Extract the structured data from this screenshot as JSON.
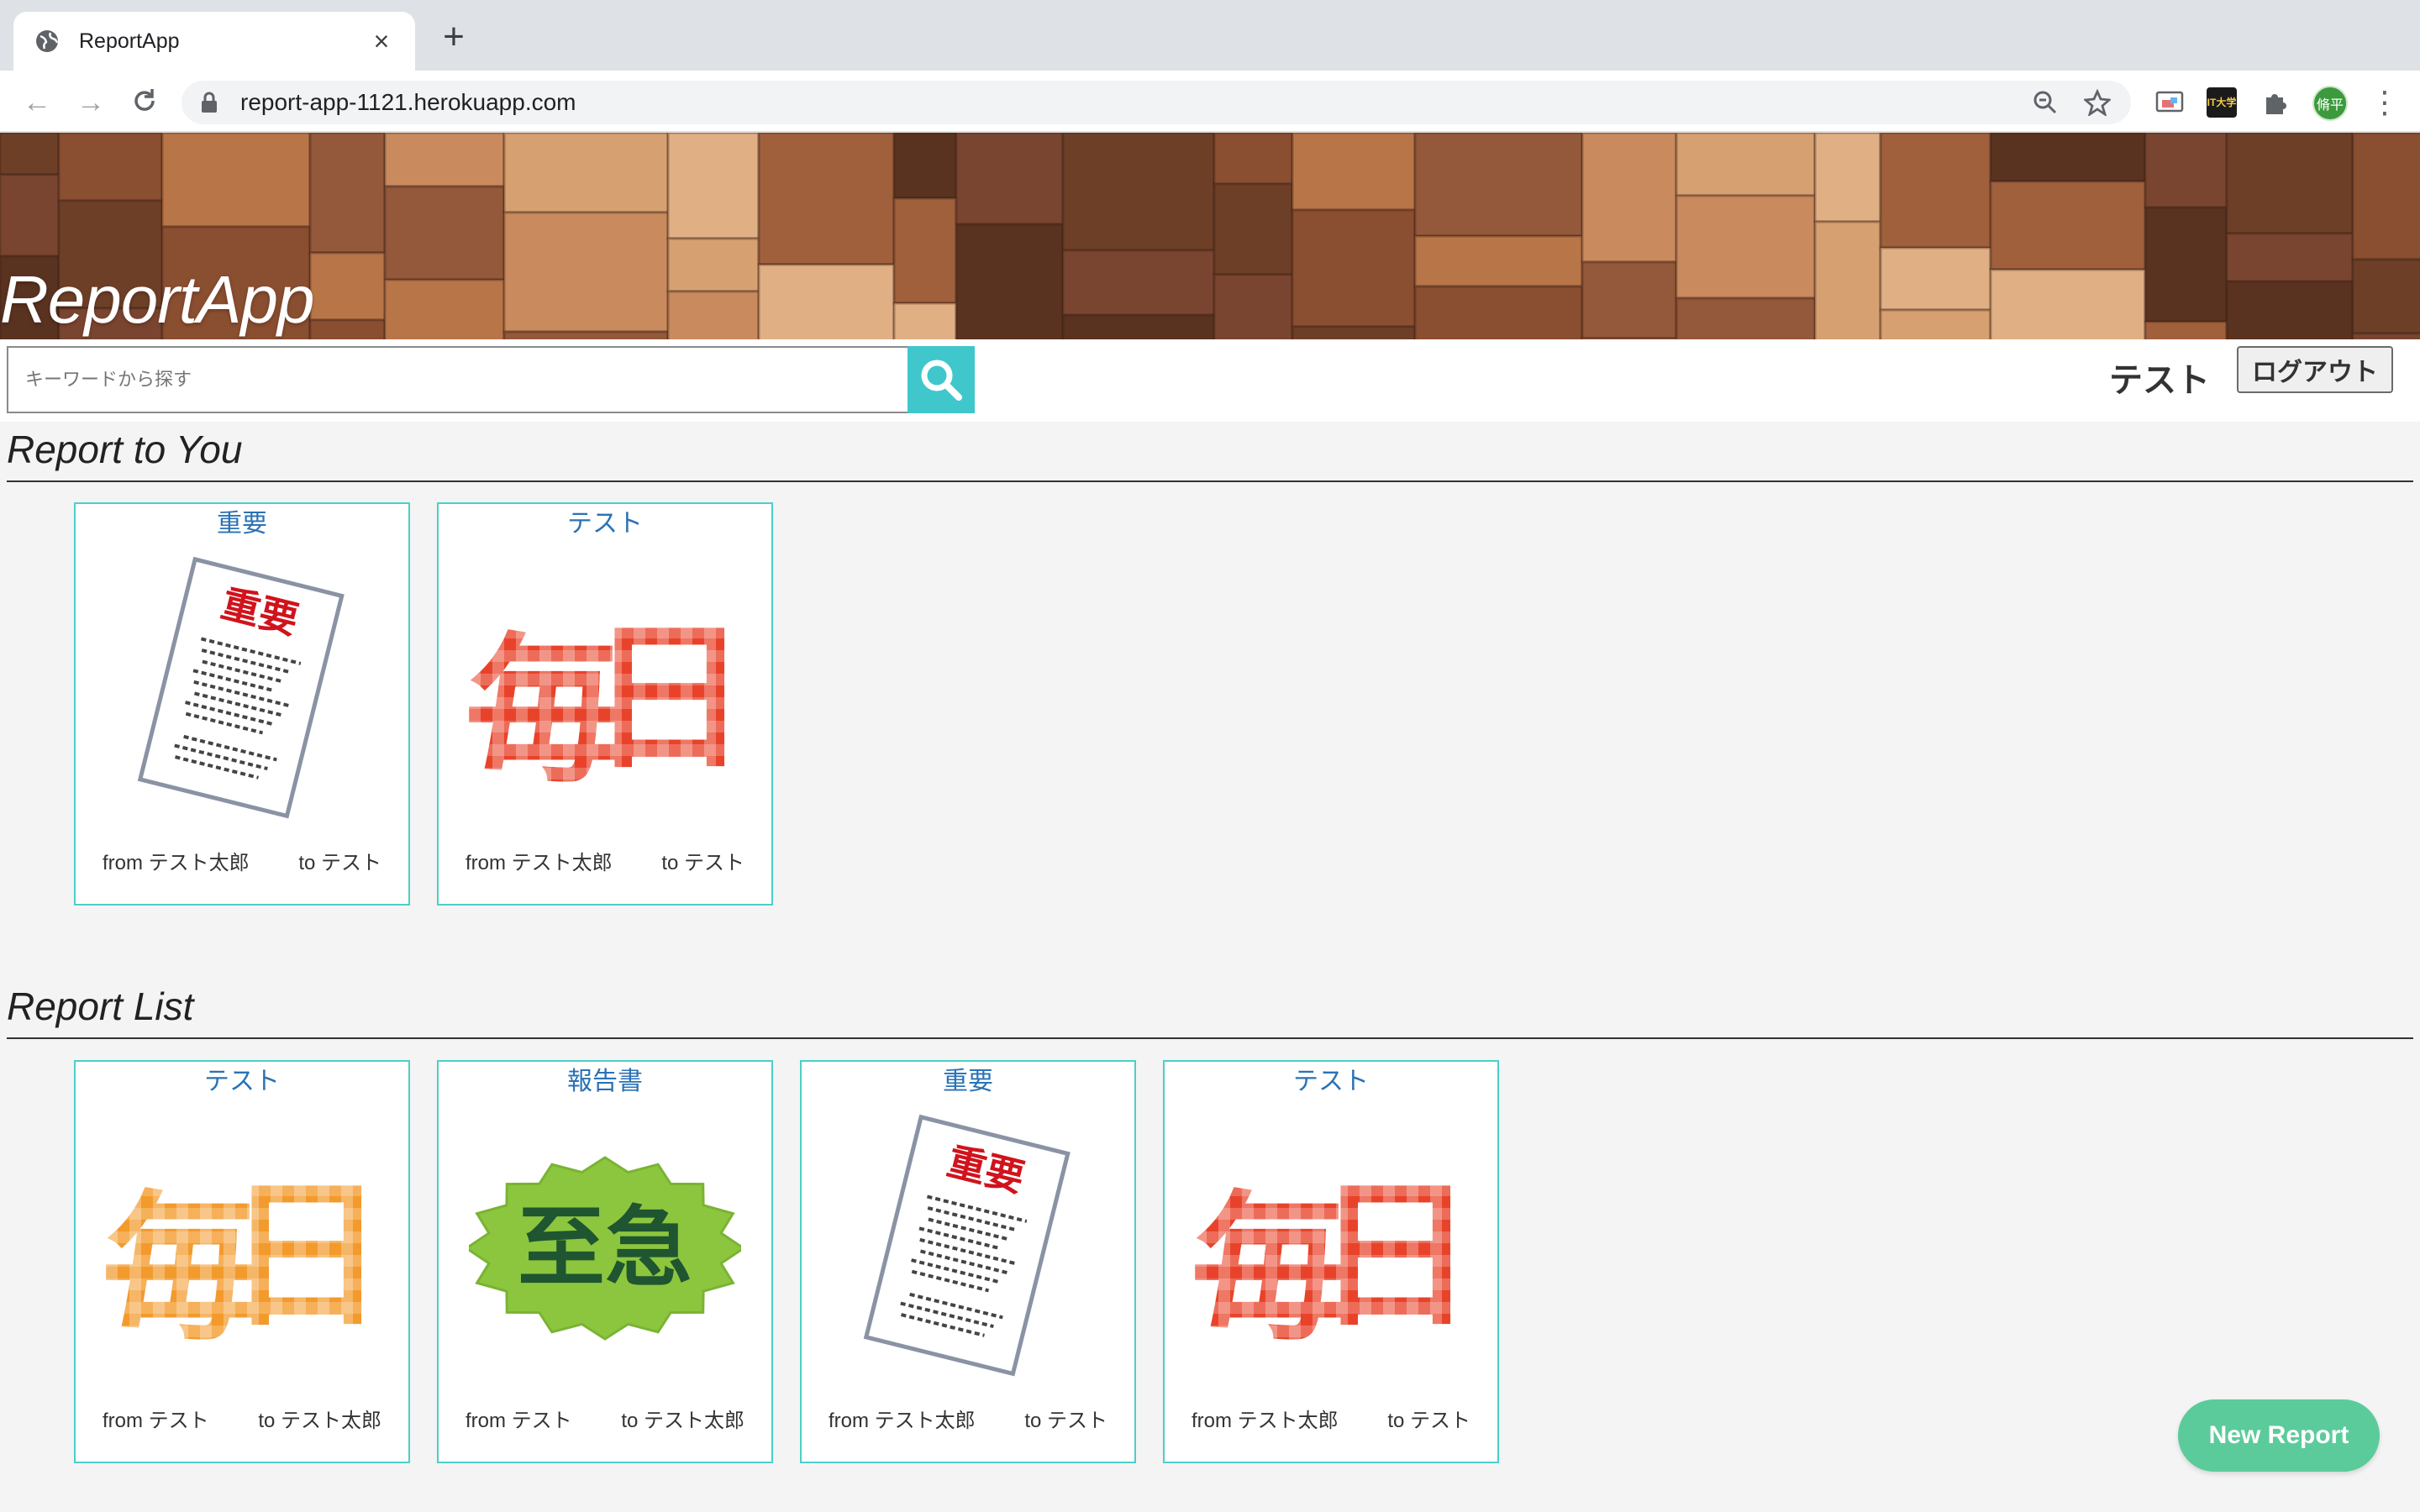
{
  "browser": {
    "tab_title": "ReportApp",
    "url": "report-app-1121.herokuapp.com",
    "profile_initials": "脩平",
    "ext_label": "IT大学"
  },
  "app": {
    "brand": "ReportApp",
    "search_placeholder": "キーワードから探す",
    "user_name": "テスト",
    "logout_label": "ログアウト",
    "new_report_label": "New Report"
  },
  "sections": {
    "to_you": {
      "title": "Report to You",
      "cards": [
        {
          "title": "重要",
          "image": "important-document-illustration",
          "from": "from テスト太郎",
          "to": "to テスト"
        },
        {
          "title": "テスト",
          "image": "mainichi-red-illustration",
          "from": "from テスト太郎",
          "to": "to テスト"
        }
      ]
    },
    "list": {
      "title": "Report List",
      "cards": [
        {
          "title": "テスト",
          "image": "mainichi-orange-illustration",
          "from": "from テスト",
          "to": "to テスト太郎"
        },
        {
          "title": "報告書",
          "image": "shikyu-urgent-illustration",
          "from": "from テスト",
          "to": "to テスト太郎"
        },
        {
          "title": "重要",
          "image": "important-document-illustration",
          "from": "from テスト太郎",
          "to": "to テスト"
        },
        {
          "title": "テスト",
          "image": "mainichi-red-illustration",
          "from": "from テスト太郎",
          "to": "to テスト"
        }
      ]
    }
  },
  "colors": {
    "accent": "#4ccfc9",
    "search_button": "#3fc7cc",
    "card_title": "#2a72b5",
    "new_report": "#5ccb9b"
  }
}
